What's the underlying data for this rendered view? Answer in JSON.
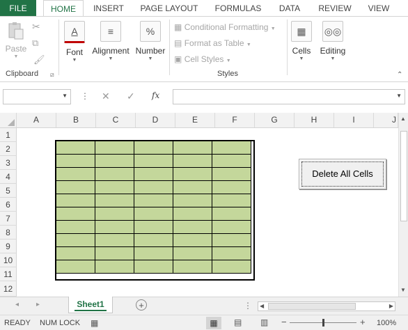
{
  "ribbon_tabs": [
    "FILE",
    "HOME",
    "INSERT",
    "PAGE LAYOUT",
    "FORMULAS",
    "DATA",
    "REVIEW",
    "VIEW"
  ],
  "active_tab": "HOME",
  "clipboard": {
    "paste_label": "Paste",
    "group_label": "Clipboard"
  },
  "font": {
    "label": "Font"
  },
  "alignment": {
    "label": "Alignment"
  },
  "number": {
    "label": "Number",
    "symbol": "%"
  },
  "styles": {
    "conditional_formatting": "Conditional Formatting",
    "format_as_table": "Format as Table",
    "cell_styles": "Cell Styles",
    "group_label": "Styles"
  },
  "cells": {
    "label": "Cells"
  },
  "editing": {
    "label": "Editing"
  },
  "formula_bar": {
    "name_box_value": "",
    "fx_label": "fx",
    "formula_value": ""
  },
  "columns": [
    "A",
    "B",
    "C",
    "D",
    "E",
    "F",
    "G",
    "H",
    "I",
    "J"
  ],
  "rows": [
    "1",
    "2",
    "3",
    "4",
    "5",
    "6",
    "7",
    "8",
    "9",
    "10",
    "11",
    "12"
  ],
  "data_range": {
    "fill_color": "#c4d79b",
    "rows": 10,
    "cols": 5
  },
  "delete_button": {
    "label": "Delete All Cells"
  },
  "sheet_tabs": [
    "Sheet1"
  ],
  "status": {
    "mode": "READY",
    "num_lock": "NUM LOCK",
    "zoom": "100%"
  },
  "colors": {
    "brand": "#217346",
    "accent_text": "#217346"
  }
}
